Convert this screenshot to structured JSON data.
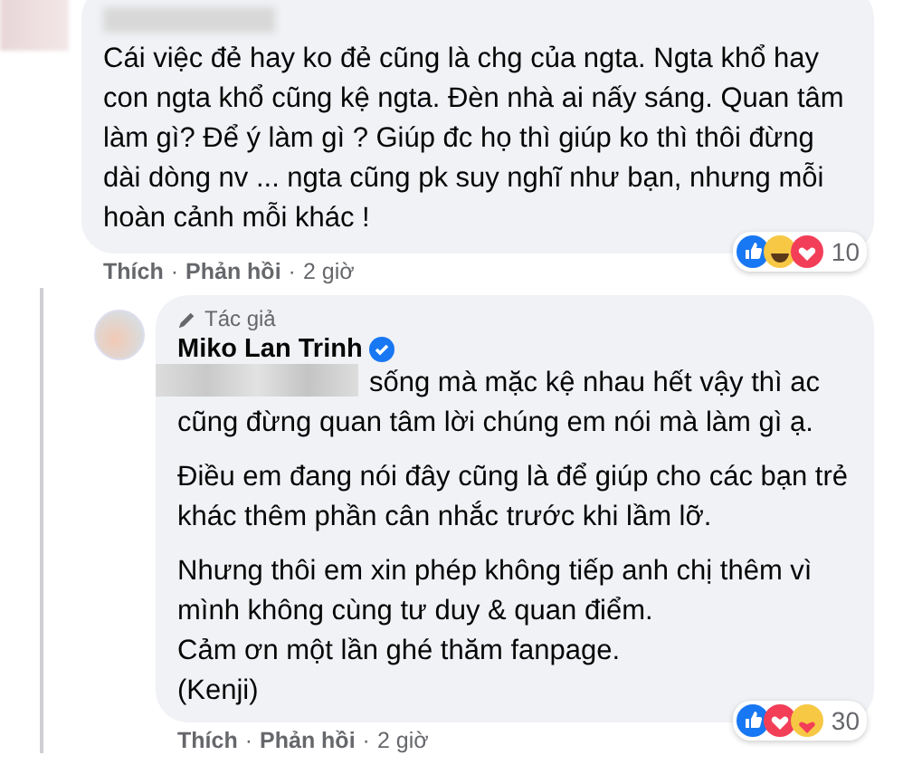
{
  "comment": {
    "text": "Cái việc đẻ hay ko đẻ cũng là chg của ngta. Ngta khổ hay con ngta khổ cũng kệ ngta. Đèn nhà ai nấy sáng. Quan tâm làm gì? Để ý làm gì ? Giúp đc họ thì giúp ko thì thôi đừng dài dòng nv ... ngta cũng pk suy nghĩ như bạn, nhưng mỗi hoàn cảnh mỗi khác !",
    "reactions": [
      {
        "kind": "like"
      },
      {
        "kind": "haha"
      },
      {
        "kind": "love"
      }
    ],
    "reaction_count": "10",
    "actions": {
      "like": "Thích",
      "separator_1": "·",
      "reply": "Phản hồi",
      "separator_2": "·",
      "time": "2 giờ"
    }
  },
  "reply": {
    "badge": "Tác giả",
    "author": "Miko Lan Trinh",
    "verified": true,
    "paragraphs": [
      {
        "redacted_prefix": true,
        "text": "sống mà mặc kệ nhau hết vậy thì ac cũng đừng quan tâm lời chúng em nói mà làm gì ạ."
      },
      {
        "redacted_prefix": false,
        "text": "Điều em đang nói đây cũng là để giúp cho các bạn trẻ khác thêm phần cân nhắc trước khi lầm lỡ."
      },
      {
        "redacted_prefix": false,
        "text": "Nhưng thôi em xin phép không tiếp anh chị thêm vì mình không cùng tư duy & quan điểm.\nCảm ơn một lần ghé thăm fanpage.\n(Kenji)"
      }
    ],
    "reactions": [
      {
        "kind": "like"
      },
      {
        "kind": "love"
      },
      {
        "kind": "care"
      }
    ],
    "reaction_count": "30",
    "actions": {
      "like": "Thích",
      "separator_1": "·",
      "reply": "Phản hồi",
      "separator_2": "·",
      "time": "2 giờ"
    }
  }
}
